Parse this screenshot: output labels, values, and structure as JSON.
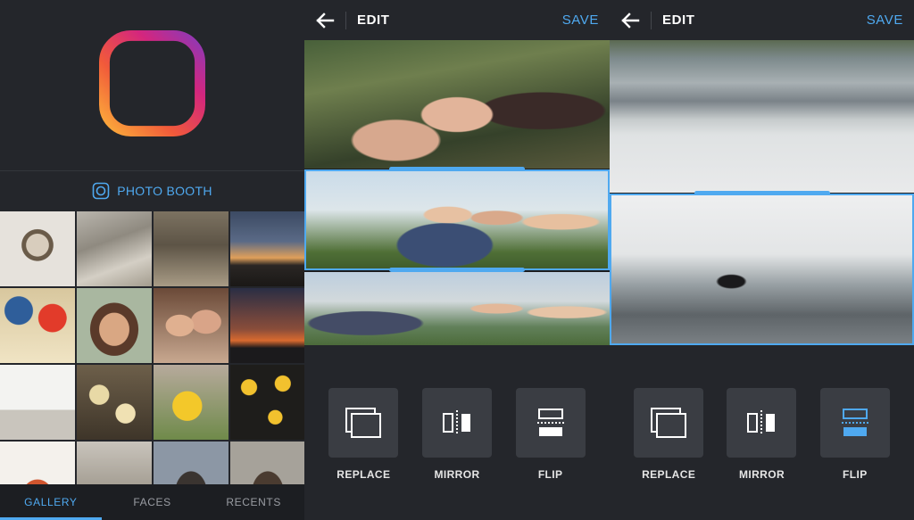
{
  "gallery_screen": {
    "photo_booth_label": "PHOTO BOOTH",
    "tabs": [
      {
        "label": "GALLERY",
        "active": true
      },
      {
        "label": "FACES",
        "active": false
      },
      {
        "label": "RECENTS",
        "active": false
      }
    ],
    "thumbnail_count": 16
  },
  "editor_screen_1": {
    "title": "EDIT",
    "save_label": "SAVE",
    "tools": [
      {
        "label": "REPLACE",
        "icon": "replace-icon"
      },
      {
        "label": "MIRROR",
        "icon": "mirror-icon"
      },
      {
        "label": "FLIP",
        "icon": "flip-icon"
      }
    ]
  },
  "editor_screen_2": {
    "title": "EDIT",
    "save_label": "SAVE",
    "tools": [
      {
        "label": "REPLACE",
        "icon": "replace-icon"
      },
      {
        "label": "MIRROR",
        "icon": "mirror-icon"
      },
      {
        "label": "FLIP",
        "icon": "flip-icon",
        "active": true
      }
    ]
  },
  "colors": {
    "accent": "#4fa9f0",
    "background": "#24262b",
    "tool_button": "#3a3d43"
  }
}
